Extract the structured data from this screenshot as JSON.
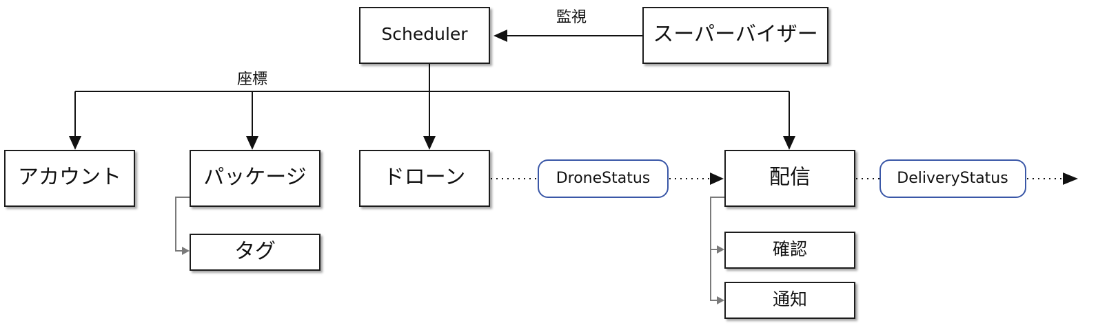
{
  "nodes": {
    "scheduler": "Scheduler",
    "supervisor": "スーパーバイザー",
    "account": "アカウント",
    "package": "パッケージ",
    "drone": "ドローン",
    "delivery": "配信",
    "tag": "タグ",
    "confirm": "確認",
    "notify": "通知"
  },
  "status": {
    "drone_status": "DroneStatus",
    "delivery_status": "DeliveryStatus"
  },
  "edge_labels": {
    "monitor": "監視",
    "coordinate": "座標"
  },
  "colors": {
    "status_border": "#3a57a7",
    "sub_connector": "#7a7a7a"
  }
}
